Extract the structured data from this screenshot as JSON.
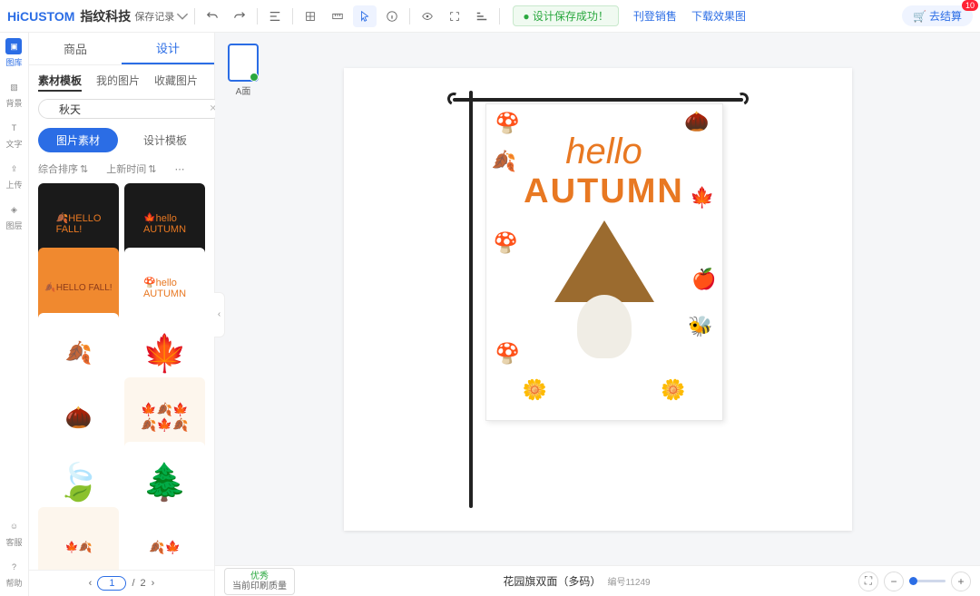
{
  "brand": {
    "hi": "Hi",
    "custom": "CUSTOM",
    "cn": "指纹科技"
  },
  "topbar": {
    "save_record": "保存记录",
    "success_msg": "设计保存成功！",
    "publish": "刊登销售",
    "download": "下载效果图",
    "cart": "去结算",
    "cart_count": "10"
  },
  "rail": [
    {
      "label": "图库",
      "active": true
    },
    {
      "label": "背景"
    },
    {
      "label": "文字"
    },
    {
      "label": "上传"
    },
    {
      "label": "图层"
    }
  ],
  "rail_bottom": [
    {
      "label": "客服"
    },
    {
      "label": "帮助"
    }
  ],
  "panel": {
    "tabs": [
      {
        "label": "商品"
      },
      {
        "label": "设计",
        "active": true
      }
    ],
    "subtabs": [
      {
        "label": "素材模板",
        "active": true
      },
      {
        "label": "我的图片"
      },
      {
        "label": "收藏图片"
      }
    ],
    "search_value": "秋天",
    "pills": [
      {
        "label": "图片素材",
        "active": true
      },
      {
        "label": "设计模板"
      }
    ],
    "sort": [
      {
        "label": "综合排序"
      },
      {
        "label": "上新时间"
      }
    ],
    "pager": {
      "current": "1",
      "total": "2"
    }
  },
  "page_thumb": "A面",
  "flag": {
    "line1": "hello",
    "line2": "AUTUMN"
  },
  "bottom": {
    "quality_tag": "优秀",
    "quality_desc": "当前印刷质量",
    "product": "花园旗双面（多码）",
    "code": "编号11249"
  }
}
